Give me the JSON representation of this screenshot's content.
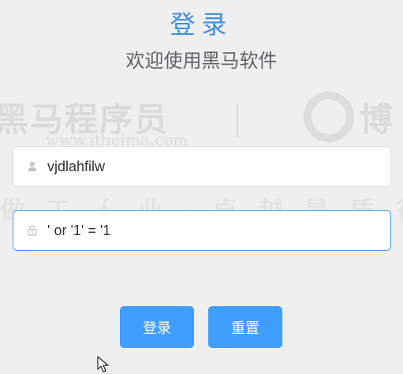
{
  "colors": {
    "accent": "#409eff",
    "title": "#3f8ee6",
    "background": "#efefef",
    "input_border": "#dcdfe6"
  },
  "header": {
    "title": "登录",
    "subtitle": "欢迎使用黑马软件"
  },
  "background": {
    "watermark_brand": "黑马程序员",
    "watermark_url": "www.itheima.com",
    "watermark_right": "博",
    "watermark_slogan": "做 工 ∮  业 ·  卓 越 是 质 行 业"
  },
  "form": {
    "username": {
      "icon": "user-icon",
      "value": "vjdlahfilw"
    },
    "password": {
      "icon": "lock-icon",
      "value": "' or '1' = '1"
    }
  },
  "actions": {
    "login_label": "登录",
    "reset_label": "重置"
  }
}
